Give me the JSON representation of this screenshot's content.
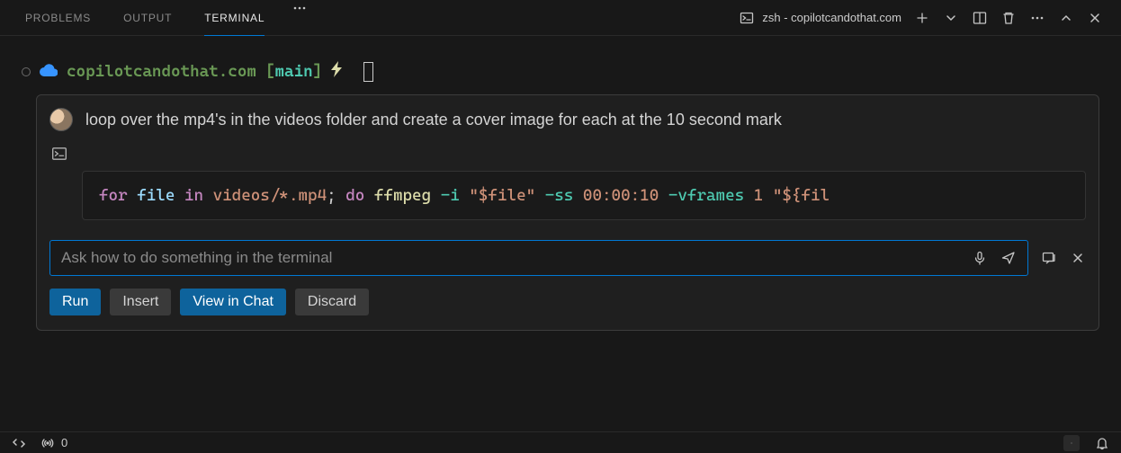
{
  "tabs": {
    "problems": "PROBLEMS",
    "output": "OUTPUT",
    "terminal": "TERMINAL"
  },
  "terminal_label": "zsh - copilotcandothat.com",
  "prompt": {
    "cwd": "copilotcandothat.com",
    "branch": "main"
  },
  "suggest": {
    "user_text": "loop over the mp4's in the videos folder and create a cover image for each at the 10 second mark",
    "code_tokens": [
      {
        "cls": "kw",
        "t": "for"
      },
      {
        "cls": "",
        "t": " "
      },
      {
        "cls": "var",
        "t": "file"
      },
      {
        "cls": "",
        "t": " "
      },
      {
        "cls": "kw",
        "t": "in"
      },
      {
        "cls": "",
        "t": " "
      },
      {
        "cls": "path",
        "t": "videos/*.mp4"
      },
      {
        "cls": "",
        "t": "; "
      },
      {
        "cls": "kw",
        "t": "do"
      },
      {
        "cls": "",
        "t": " "
      },
      {
        "cls": "cmd",
        "t": "ffmpeg"
      },
      {
        "cls": "",
        "t": " "
      },
      {
        "cls": "opt",
        "t": "-i"
      },
      {
        "cls": "",
        "t": " "
      },
      {
        "cls": "str",
        "t": "\"$file\""
      },
      {
        "cls": "",
        "t": " "
      },
      {
        "cls": "opt",
        "t": "-ss"
      },
      {
        "cls": "",
        "t": " "
      },
      {
        "cls": "str",
        "t": "00:00:10"
      },
      {
        "cls": "",
        "t": " "
      },
      {
        "cls": "opt",
        "t": "-vframes"
      },
      {
        "cls": "",
        "t": " "
      },
      {
        "cls": "str",
        "t": "1"
      },
      {
        "cls": "",
        "t": " "
      },
      {
        "cls": "str",
        "t": "\"${fil"
      }
    ],
    "input_placeholder": "Ask how to do something in the terminal",
    "buttons": {
      "run": "Run",
      "insert": "Insert",
      "view": "View in Chat",
      "discard": "Discard"
    }
  },
  "status": {
    "radio_count": "0"
  }
}
